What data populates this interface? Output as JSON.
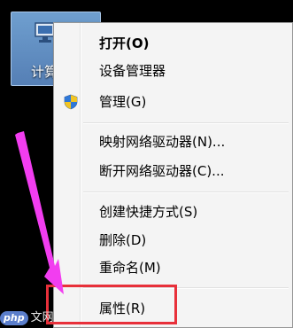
{
  "desktop": {
    "icon_label": "计算"
  },
  "context_menu": {
    "items": [
      {
        "label": "打开(O)",
        "bold": true
      },
      {
        "label": "设备管理器"
      },
      {
        "label": "管理(G)",
        "icon": "uac-shield-icon"
      },
      {
        "label": "映射网络驱动器(N)..."
      },
      {
        "label": "断开网络驱动器(C)..."
      },
      {
        "label": "创建快捷方式(S)"
      },
      {
        "label": "删除(D)"
      },
      {
        "label": "重命名(M)"
      },
      {
        "label": "属性(R)"
      }
    ]
  },
  "annotation": {
    "highlight_color": "#e8303a",
    "arrow_color": "#f23df0"
  },
  "watermark": {
    "badge": "php",
    "text": "文网"
  }
}
